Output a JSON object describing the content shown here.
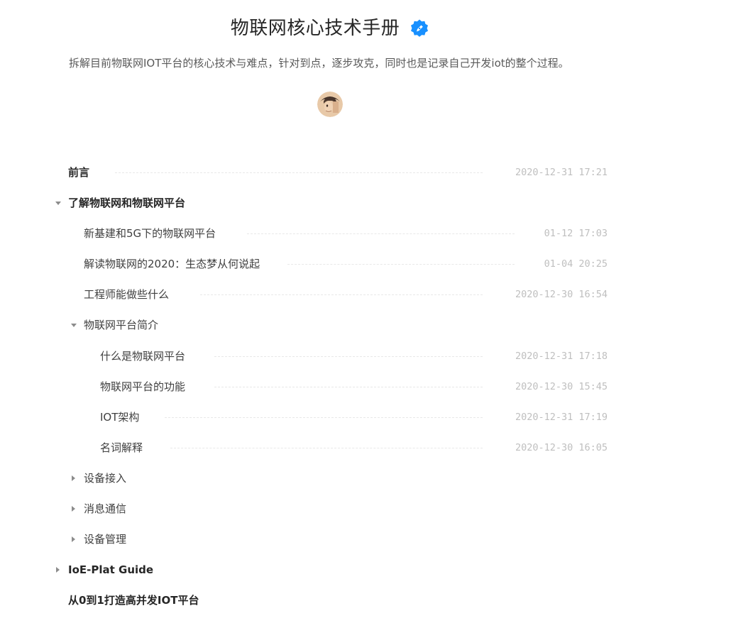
{
  "book": {
    "title": "物联网核心技术手册",
    "description": "拆解目前物联网IOT平台的核心技术与难点，针对到点，逐步攻克，同时也是记录自己开发iot的整个过程。",
    "verified_icon": "verified-badge-icon",
    "avatar": "author-avatar"
  },
  "colors": {
    "accent": "#1890ff",
    "text": "#262626",
    "muted": "#bfbfbf"
  },
  "toc": [
    {
      "label": "前言",
      "date": "2020-12-31 17:21"
    },
    {
      "label": "了解物联网和物联网平台",
      "date": ""
    },
    {
      "label": "新基建和5G下的物联网平台",
      "date": "01-12 17:03"
    },
    {
      "label": "解读物联网的2020：生态梦从何说起",
      "date": "01-04 20:25"
    },
    {
      "label": "工程师能做些什么",
      "date": "2020-12-30 16:54"
    },
    {
      "label": "物联网平台简介",
      "date": ""
    },
    {
      "label": "什么是物联网平台",
      "date": "2020-12-31 17:18"
    },
    {
      "label": "物联网平台的功能",
      "date": "2020-12-30 15:45"
    },
    {
      "label": "IOT架构",
      "date": "2020-12-31 17:19"
    },
    {
      "label": "名词解释",
      "date": "2020-12-30 16:05"
    },
    {
      "label": "设备接入",
      "date": ""
    },
    {
      "label": "消息通信",
      "date": ""
    },
    {
      "label": "设备管理",
      "date": ""
    },
    {
      "label": "IoE-Plat Guide",
      "date": ""
    },
    {
      "label": "从0到1打造高并发IOT平台",
      "date": ""
    }
  ]
}
